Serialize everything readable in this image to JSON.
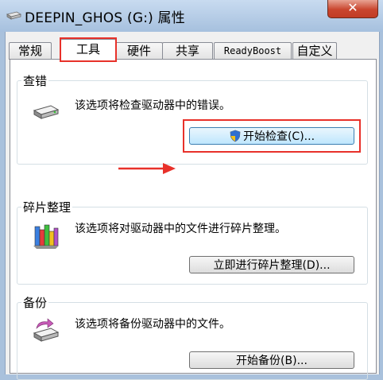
{
  "window": {
    "title": "DEEPIN_GHOS (G:) 属性",
    "close_label": "✕"
  },
  "tabs": [
    {
      "label": "常规",
      "active": false
    },
    {
      "label": "工具",
      "active": true
    },
    {
      "label": "硬件",
      "active": false
    },
    {
      "label": "共享",
      "active": false
    },
    {
      "label": "ReadyBoost",
      "active": false
    },
    {
      "label": "自定义",
      "active": false
    }
  ],
  "groups": {
    "error_check": {
      "title": "查错",
      "description": "该选项将检查驱动器中的错误。",
      "button_label": "开始检查(C)..."
    },
    "defrag": {
      "title": "碎片整理",
      "description": "该选项将对驱动器中的文件进行碎片整理。",
      "button_label": "立即进行碎片整理(D)..."
    },
    "backup": {
      "title": "备份",
      "description": "该选项将备份驱动器中的文件。",
      "button_label": "开始备份(B)..."
    }
  },
  "colors": {
    "annotation_red": "#e8312a",
    "titlebar": "#b7cde6"
  }
}
